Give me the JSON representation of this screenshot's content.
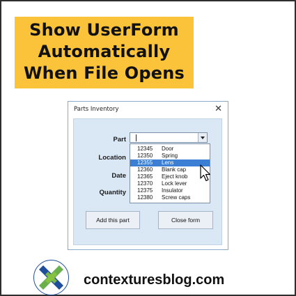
{
  "banner": {
    "line1": "Show UserForm",
    "line2": "Automatically",
    "line3": "When File Opens"
  },
  "dialog": {
    "title": "Parts Inventory",
    "close_label": "✕",
    "labels": {
      "part": "Part",
      "location": "Location",
      "date": "Date",
      "quantity": "Quantity"
    },
    "part_dropdown": {
      "items": [
        {
          "code": "12345",
          "name": "Door"
        },
        {
          "code": "12350",
          "name": "Spring"
        },
        {
          "code": "12355",
          "name": "Lens"
        },
        {
          "code": "12360",
          "name": "Blank cap"
        },
        {
          "code": "12365",
          "name": "Eject knob"
        },
        {
          "code": "12370",
          "name": "Lock lever"
        },
        {
          "code": "12375",
          "name": "Insulator"
        },
        {
          "code": "12380",
          "name": "Screw caps"
        }
      ],
      "selected_index": 2
    },
    "buttons": {
      "add": "Add this part",
      "close": "Close form"
    }
  },
  "footer": {
    "site": "contexturesblog.com",
    "logo_icon": "contextures-logo-icon"
  },
  "colors": {
    "banner_bg": "#fbc33a",
    "form_bg": "#dae7f5",
    "selection": "#3b7fd4",
    "logo_green": "#6ab04c",
    "logo_blue": "#1f4e9c"
  }
}
